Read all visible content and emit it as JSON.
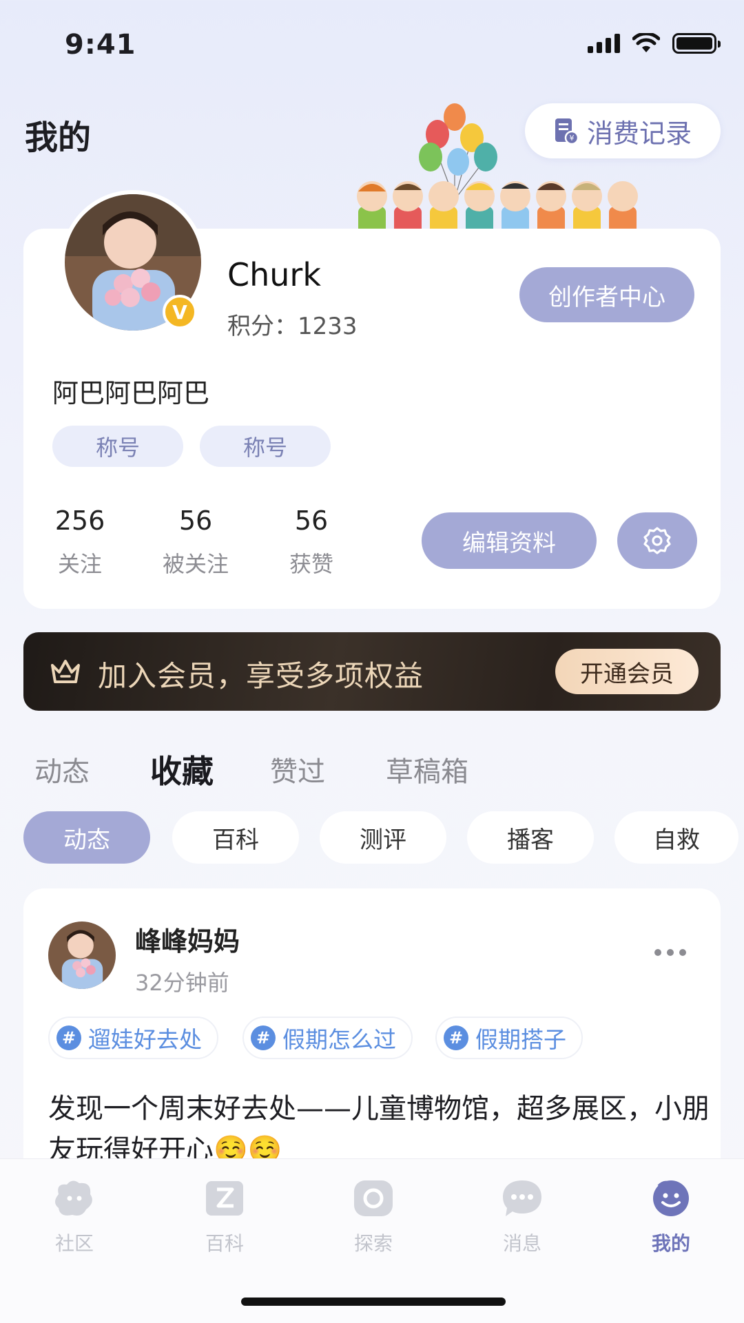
{
  "status_bar": {
    "time": "9:41"
  },
  "header": {
    "title": "我的",
    "consume_record": "消费记录"
  },
  "profile": {
    "username": "Churk",
    "points": "积分：1233",
    "verified_badge": "V",
    "creator_center": "创作者中心",
    "bio": "阿巴阿巴阿巴",
    "titles": [
      "称号",
      "称号"
    ],
    "stats": [
      {
        "value": "256",
        "label": "关注"
      },
      {
        "value": "56",
        "label": "被关注"
      },
      {
        "value": "56",
        "label": "获赞"
      }
    ],
    "edit_profile": "编辑资料"
  },
  "vip_banner": {
    "text": "加入会员，享受多项权益",
    "button": "开通会员"
  },
  "tabs": [
    {
      "label": "动态",
      "active": false
    },
    {
      "label": "收藏",
      "active": true
    },
    {
      "label": "赞过",
      "active": false
    },
    {
      "label": "草稿箱",
      "active": false
    }
  ],
  "filters": [
    {
      "label": "动态",
      "active": true
    },
    {
      "label": "百科",
      "active": false
    },
    {
      "label": "测评",
      "active": false
    },
    {
      "label": "播客",
      "active": false
    },
    {
      "label": "自救",
      "active": false
    }
  ],
  "post": {
    "author": "峰峰妈妈",
    "time": "32分钟前",
    "tags": [
      "遛娃好去处",
      "假期怎么过",
      "假期搭子"
    ],
    "content": "发现一个周末好去处——儿童博物馆，超多展区，小朋友玩得好开心☺️☺️"
  },
  "bottom_nav": [
    {
      "label": "社区",
      "icon": "community-icon",
      "active": false
    },
    {
      "label": "百科",
      "icon": "encyclopedia-icon",
      "active": false
    },
    {
      "label": "探索",
      "icon": "explore-icon",
      "active": false
    },
    {
      "label": "消息",
      "icon": "message-icon",
      "active": false
    },
    {
      "label": "我的",
      "icon": "profile-icon",
      "active": true
    }
  ],
  "colors": {
    "accent": "#a4a9d6",
    "active_nav": "#6e74b9",
    "tag_blue": "#5b8ee0",
    "vip_gold": "#ecd6b8"
  }
}
